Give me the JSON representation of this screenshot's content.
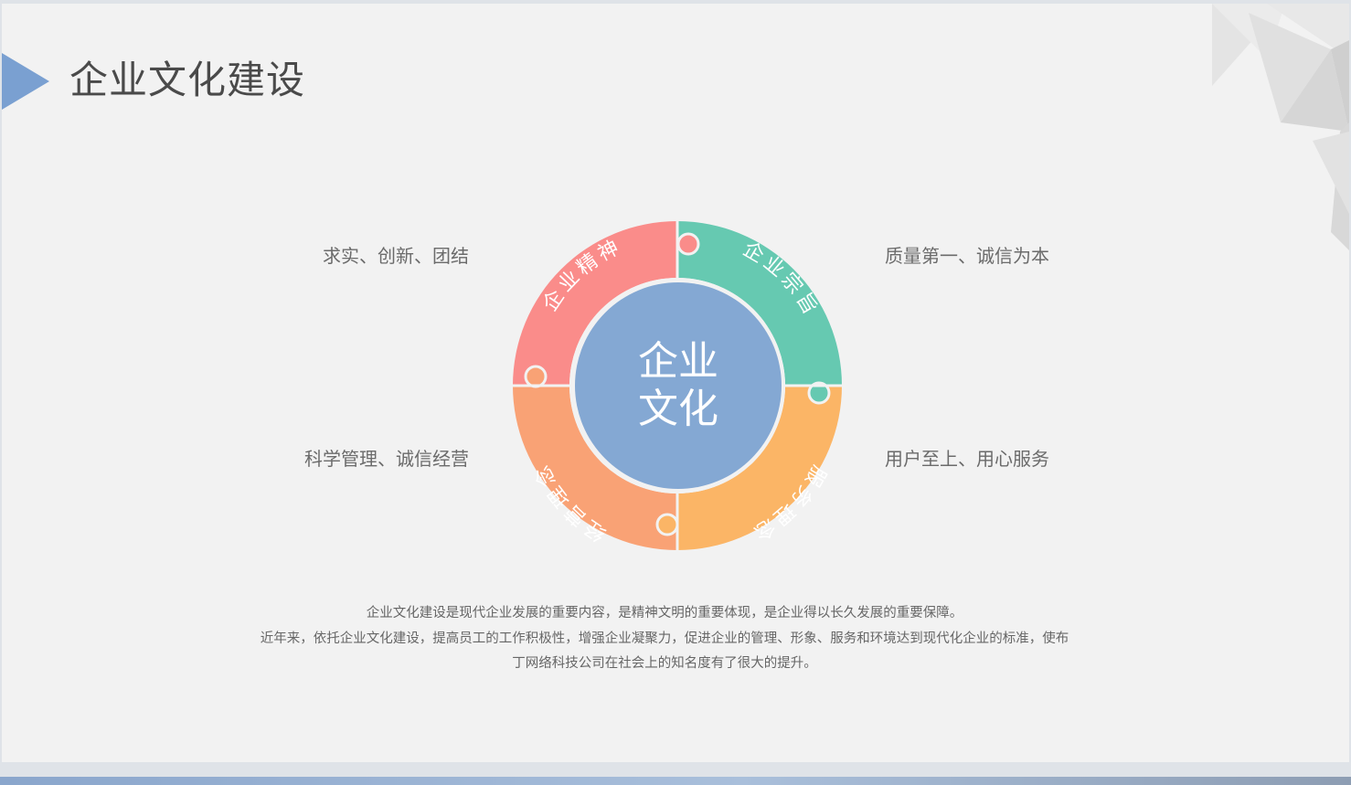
{
  "page": {
    "title": "企业文化建设"
  },
  "center": {
    "line1": "企业",
    "line2": "文化"
  },
  "segments": [
    {
      "label": "企业精神",
      "color": "#fa8c8a",
      "side_text": "求实、创新、团结"
    },
    {
      "label": "企业宗旨",
      "color": "#66c9b1",
      "side_text": "质量第一、诚信为本"
    },
    {
      "label": "服务理念",
      "color": "#fbb566",
      "side_text": "用户至上、用心服务"
    },
    {
      "label": "经营理念",
      "color": "#f9a275",
      "side_text": "科学管理、诚信经营"
    }
  ],
  "description": {
    "line1": "企业文化建设是现代企业发展的重要内容，是精神文明的重要体现，是企业得以长久发展的重要保障。",
    "line2": "近年来，依托企业文化建设，提高员工的工作积极性，增强企业凝聚力，促进企业的管理、形象、服务和环境达到现代化企业的标准，使布",
    "line3": "丁网络科技公司在社会上的知名度有了很大的提升。"
  },
  "colors": {
    "center": "#84a8d3",
    "accent_arrow": "#6f9ad0",
    "title": "#4a4a4a"
  }
}
